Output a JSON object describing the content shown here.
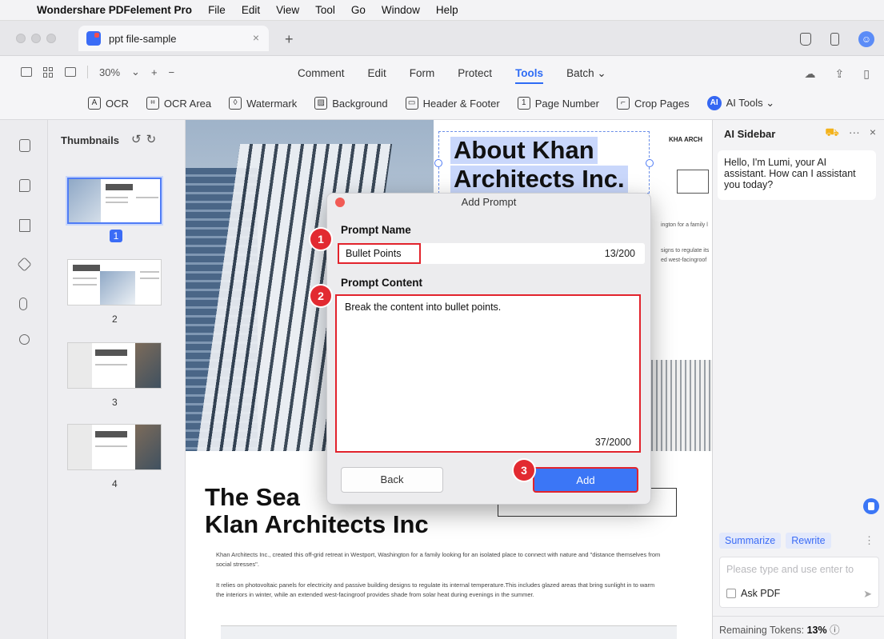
{
  "menubar": {
    "app_name": "Wondershare PDFelement Pro",
    "items": [
      "File",
      "Edit",
      "View",
      "Tool",
      "Go",
      "Window",
      "Help"
    ]
  },
  "tab": {
    "name": "ppt file-sample"
  },
  "toolbar1": {
    "zoom": "30%",
    "menu": [
      "Comment",
      "Edit",
      "Form",
      "Protect",
      "Tools",
      "Batch ⌄"
    ],
    "active_menu": "Tools"
  },
  "toolbar2": {
    "tools": [
      {
        "icon": "ocr-icon",
        "glyph": "A",
        "label": "OCR"
      },
      {
        "icon": "ocr-area-icon",
        "glyph": "⌗",
        "label": "OCR Area"
      },
      {
        "icon": "watermark-icon",
        "glyph": "◊",
        "label": "Watermark"
      },
      {
        "icon": "background-icon",
        "glyph": "▨",
        "label": "Background"
      },
      {
        "icon": "header-footer-icon",
        "glyph": "▭",
        "label": "Header & Footer"
      },
      {
        "icon": "page-number-icon",
        "glyph": "1",
        "label": "Page Number"
      },
      {
        "icon": "crop-pages-icon",
        "glyph": "⌐",
        "label": "Crop Pages"
      },
      {
        "icon": "ai-tools-icon",
        "glyph": "AI",
        "label": "AI Tools ⌄"
      }
    ]
  },
  "thumbnails": {
    "title": "Thumbnails",
    "pages": [
      "1",
      "2",
      "3",
      "4"
    ],
    "selected_page": "1"
  },
  "document": {
    "title_line1": "About Khan",
    "title_line2": "Architects Inc.",
    "big_title_line1": "The Sea",
    "big_title_line2": "Klan Architects Inc",
    "para1": "Khan Architects Inc., created this off-grid retreat in Westport, Washington for a family looking for an isolated place to connect with nature and \"distance themselves from social stresses\".",
    "para2": "It relies on photovoltaic panels for electricity and passive building designs to regulate its internal temperature.This includes glazed areas that bring sunlight in to warm the interiors in winter, while an extended west-facingroof provides shade from solar heat during evenings in the summer.",
    "logo_text": "KHA ARCH",
    "snippet1": "ington for a family l",
    "snippet2": "signs to regulate its",
    "snippet3": "ed west-facingroof"
  },
  "modal": {
    "title": "Add Prompt",
    "prompt_name_label": "Prompt Name",
    "prompt_name_value": "Bullet Points",
    "prompt_name_counter": "13/200",
    "prompt_content_label": "Prompt Content",
    "prompt_content_value": "Break the content into bullet points.",
    "prompt_content_counter": "37/2000",
    "back_label": "Back",
    "add_label": "Add",
    "badges": [
      "1",
      "2",
      "3"
    ]
  },
  "ai_sidebar": {
    "title": "AI Sidebar",
    "greeting": "Hello, I'm Lumi, your AI assistant. How can I assistant you today?",
    "chips": [
      "Summarize",
      "Rewrite"
    ],
    "input_placeholder": "Please type and use enter to",
    "ask_pdf_label": "Ask PDF",
    "tokens_label": "Remaining Tokens:",
    "tokens_value": "13%"
  },
  "colors": {
    "accent": "#3b76f6",
    "highlight_red": "#e2232c"
  }
}
